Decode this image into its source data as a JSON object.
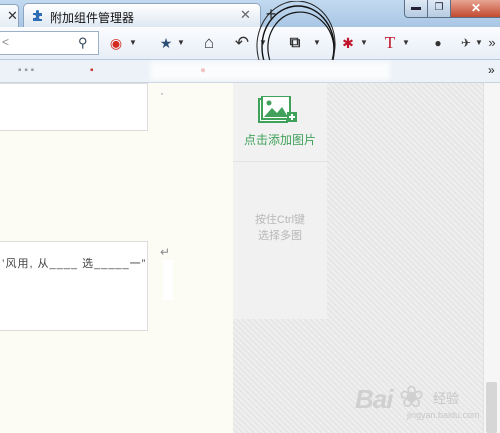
{
  "tabs": [
    {
      "label": "附加组件管理器",
      "close": "✕"
    }
  ],
  "tab_stub_close": "✕",
  "new_tab": "+",
  "window_controls": {
    "minimize": "▬",
    "maximize": "❐",
    "close": "✕"
  },
  "url_bar": {
    "value_fragment": "<",
    "search_icon": "⚲"
  },
  "toolbar": {
    "buttons": [
      {
        "name": "weibo-icon",
        "glyph": "◉",
        "color": "#d52b1e"
      },
      {
        "name": "bookmark-star-icon",
        "glyph": "★",
        "color": "#2b4e76"
      },
      {
        "name": "home-icon",
        "glyph": "⌂",
        "color": "#333333"
      },
      {
        "name": "undo-icon",
        "glyph": "↶",
        "color": "#333333"
      },
      {
        "name": "crop-icon",
        "glyph": "⧉",
        "color": "#111111"
      },
      {
        "name": "asterisk-icon",
        "glyph": "✱",
        "color": "#c0152a"
      },
      {
        "name": "text-icon",
        "glyph": "T",
        "color": "#c0152a"
      },
      {
        "name": "chat-icon",
        "glyph": "●",
        "color": "#333333"
      },
      {
        "name": "extension-icon",
        "glyph": "✈",
        "color": "#333333"
      }
    ],
    "overflow": "»"
  },
  "bookmarks": {
    "overflow": "»"
  },
  "image_panel": {
    "add_label": "点击添加图片",
    "multi_line1": "按住Ctrl键",
    "multi_line2": "选择多图"
  },
  "left_cards": {
    "card2_text": "’风用, 从____ 选_____一”"
  },
  "watermark": {
    "brand": "Bai",
    "suffix": "经验",
    "url": "jingyan.baidu.com"
  },
  "colors": {
    "accent_green": "#3fa15a",
    "hint_gray": "#b8b8b8",
    "tabstrip_blue": "#a9c6e4"
  }
}
